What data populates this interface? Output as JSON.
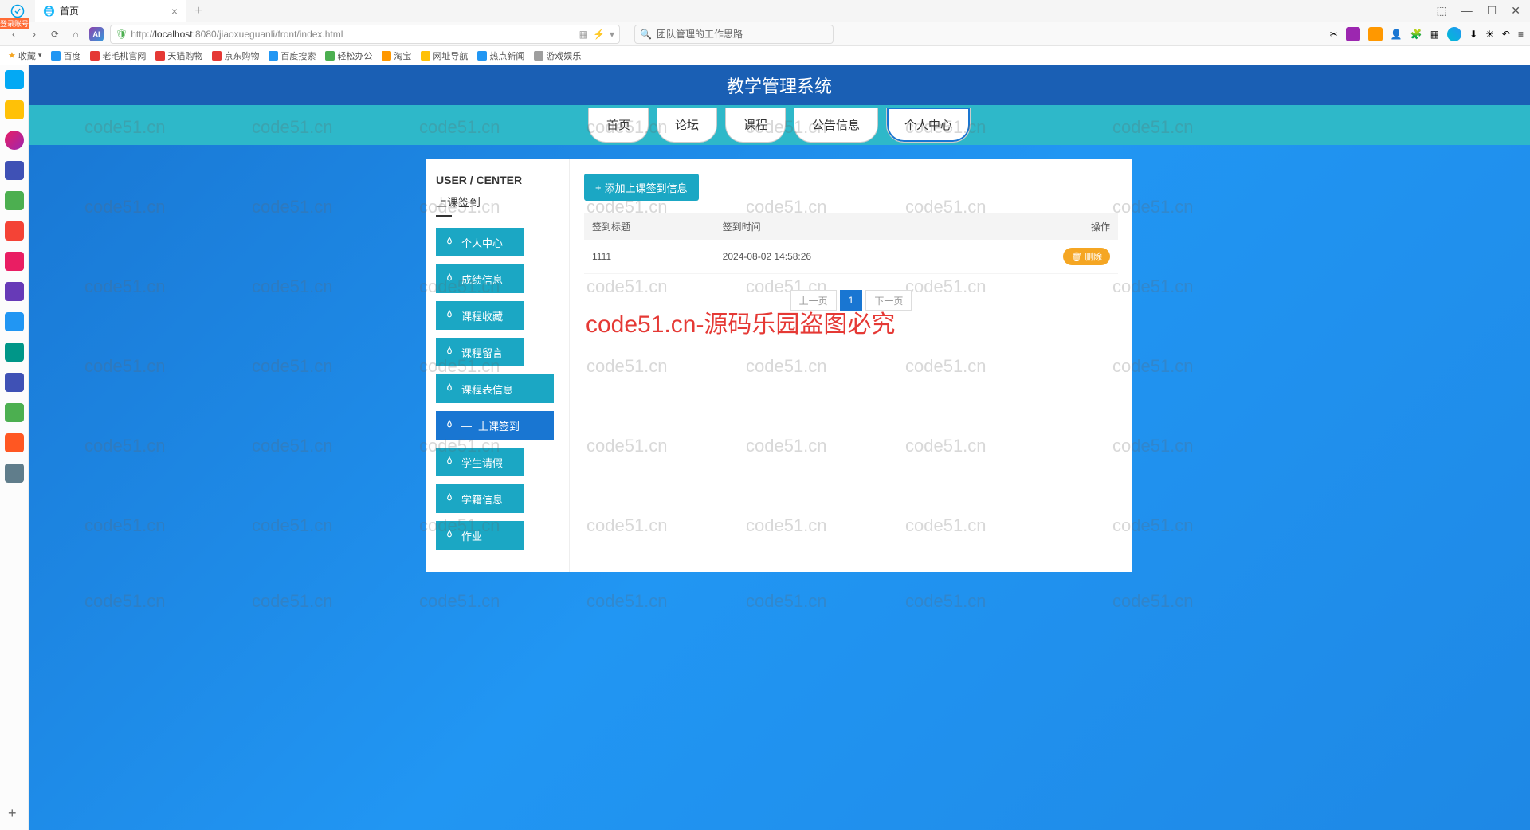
{
  "browser": {
    "tab_title": "首页",
    "url_prefix": "http://",
    "url_host": "localhost",
    "url_port": ":8080",
    "url_path": "/jiaoxueguanli/front/index.html",
    "search_placeholder": "团队管理的工作思路",
    "badge_left": "登录账号",
    "window_controls": {
      "split": "⬚",
      "min": "—",
      "max": "☐",
      "close": "✕"
    }
  },
  "bookmarks": [
    {
      "label": "收藏",
      "color": "#f5a623"
    },
    {
      "label": "百度",
      "color": "#2196f3"
    },
    {
      "label": "老毛桃官网",
      "color": "#e53935"
    },
    {
      "label": "天猫购物",
      "color": "#e53935"
    },
    {
      "label": "京东购物",
      "color": "#e53935"
    },
    {
      "label": "百度搜索",
      "color": "#2196f3"
    },
    {
      "label": "轻松办公",
      "color": "#4caf50"
    },
    {
      "label": "淘宝",
      "color": "#ff9800"
    },
    {
      "label": "网址导航",
      "color": "#ffc107"
    },
    {
      "label": "热点新闻",
      "color": "#2196f3"
    },
    {
      "label": "游戏娱乐",
      "color": "#9e9e9e"
    }
  ],
  "header": {
    "title": "教学管理系统"
  },
  "nav": [
    {
      "label": "首页"
    },
    {
      "label": "论坛"
    },
    {
      "label": "课程"
    },
    {
      "label": "公告信息"
    },
    {
      "label": "个人中心",
      "active": true
    }
  ],
  "sidebar": {
    "title": "USER / CENTER",
    "subtitle": "上课签到",
    "items": [
      {
        "label": "个人中心"
      },
      {
        "label": "成绩信息"
      },
      {
        "label": "课程收藏"
      },
      {
        "label": "课程留言"
      },
      {
        "label": "课程表信息",
        "wide": true
      },
      {
        "label": "上课签到",
        "active": true
      },
      {
        "label": "学生请假"
      },
      {
        "label": "学籍信息"
      },
      {
        "label": "作业"
      }
    ]
  },
  "main": {
    "add_button": "添加上课签到信息",
    "columns": {
      "col1": "签到标题",
      "col2": "签到时间",
      "col3": "操作"
    },
    "rows": [
      {
        "title": "1111",
        "time": "2024-08-02 14:58:26",
        "del": "删除"
      }
    ],
    "pager": {
      "prev": "上一页",
      "page": "1",
      "next": "下一页"
    }
  },
  "big_watermark": "code51.cn-源码乐园盗图必究",
  "wm_small": "code51.cn"
}
